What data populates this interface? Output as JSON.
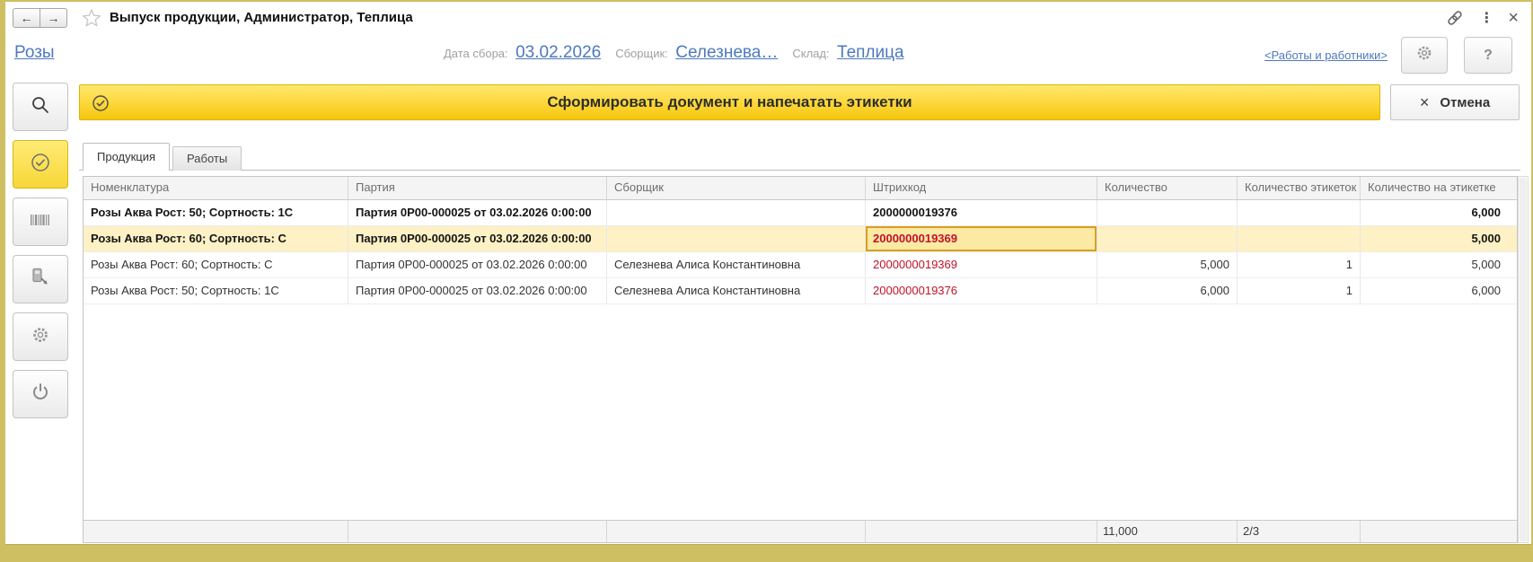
{
  "colors": {
    "frame_background": "#cdbf62",
    "accent_yellow": "#f7c800",
    "link_blue": "#4d79bd",
    "barcode_red": "#bf1228",
    "selected_row": "#fdf1c5",
    "edit_cell_border": "#d99f1e"
  },
  "titlebar": {
    "title": "Выпуск продукции, Администратор, Теплица",
    "back_icon": "←",
    "forward_icon": "→",
    "star_icon": "star-outline",
    "link_icon": "chain",
    "menu_icon": "⋮",
    "close_icon": "×"
  },
  "header": {
    "main_link": "Розы",
    "fields": [
      {
        "label": "Дата сбора:",
        "value": "03.02.2026"
      },
      {
        "label": "Сборщик:",
        "value": "Селезнева…"
      },
      {
        "label": "Склад:",
        "value": "Теплица"
      }
    ],
    "works_link": "<Работы и работники>",
    "settings_icon": "gear",
    "help_label": "?"
  },
  "toolbar": {
    "main_button": "Сформировать документ и напечатать этикетки",
    "main_button_icon": "check-circle",
    "cancel_icon": "×",
    "cancel_label": "Отмена"
  },
  "sidebar": {
    "buttons": [
      {
        "name": "search",
        "icon": "magnifier",
        "active": false
      },
      {
        "name": "confirm",
        "icon": "check-circle",
        "active": true
      },
      {
        "name": "barcode",
        "icon": "barcode",
        "active": false
      },
      {
        "name": "data-terminal",
        "icon": "terminal-arrow",
        "active": false
      },
      {
        "name": "settings",
        "icon": "gear",
        "active": false
      },
      {
        "name": "power",
        "icon": "power",
        "active": false
      }
    ]
  },
  "tabs": [
    {
      "label": "Продукция",
      "active": true
    },
    {
      "label": "Работы",
      "active": false
    }
  ],
  "table": {
    "columns": [
      "Номенклатура",
      "Партия",
      "Сборщик",
      "Штрихкод",
      "Количество",
      "Количество этикеток",
      "Количество на этикетке"
    ],
    "rows": [
      {
        "nomenclature": "Розы Аква Рост: 50; Сортность: 1С",
        "batch": "Партия 0Р00-000025 от 03.02.2026 0:00:00",
        "collector": "",
        "barcode": "2000000019376",
        "qty": "",
        "labels_qty": "",
        "qty_per_label": "6,000",
        "bold": true,
        "selected": false,
        "barcode_editing": false
      },
      {
        "nomenclature": "Розы Аква Рост: 60; Сортность: С",
        "batch": "Партия 0Р00-000025 от 03.02.2026 0:00:00",
        "collector": "",
        "barcode": "2000000019369",
        "qty": "",
        "labels_qty": "",
        "qty_per_label": "5,000",
        "bold": true,
        "selected": true,
        "barcode_editing": true
      },
      {
        "nomenclature": "Розы Аква Рост: 60; Сортность: С",
        "batch": "Партия 0Р00-000025 от 03.02.2026 0:00:00",
        "collector": "Селезнева Алиса Константиновна",
        "barcode": "2000000019369",
        "qty": "5,000",
        "labels_qty": "1",
        "qty_per_label": "5,000",
        "bold": false,
        "selected": false,
        "barcode_editing": false
      },
      {
        "nomenclature": "Розы Аква Рост: 50; Сортность: 1С",
        "batch": "Партия 0Р00-000025 от 03.02.2026 0:00:00",
        "collector": "Селезнева Алиса Константиновна",
        "barcode": "2000000019376",
        "qty": "6,000",
        "labels_qty": "1",
        "qty_per_label": "6,000",
        "bold": false,
        "selected": false,
        "barcode_editing": false
      }
    ],
    "footer": {
      "quantity_total": "11,000",
      "labels_total": "2/3"
    }
  }
}
